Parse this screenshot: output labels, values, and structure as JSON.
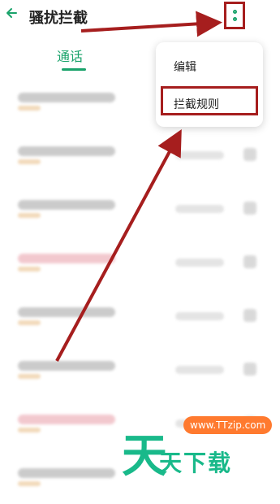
{
  "header": {
    "back_icon": "arrow-left-icon",
    "title": "骚扰拦截",
    "more_icon": "more-vertical-icon"
  },
  "tabs": [
    {
      "label": "通话",
      "active": true
    }
  ],
  "menu": {
    "items": [
      {
        "label": "编辑"
      },
      {
        "label": "拦截规则",
        "highlighted": true
      }
    ]
  },
  "watermark": {
    "logo": "天",
    "text": "天下载",
    "url": "www.TTzip.com"
  },
  "colors": {
    "accent": "#1aa36b",
    "annotation": "#a61e1e",
    "watermark_green": "#19b98a",
    "watermark_orange": "#ff7a2f"
  }
}
